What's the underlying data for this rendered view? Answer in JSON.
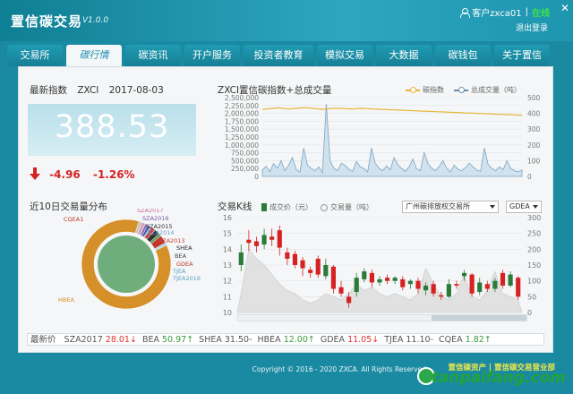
{
  "app": {
    "title": "置信碳交易",
    "version": "V1.0.0"
  },
  "user": {
    "label": "客户zxca01",
    "separator": "|",
    "status": "在线",
    "logout": "退出登录"
  },
  "tabs": [
    {
      "label": "交易所"
    },
    {
      "label": "碳行情"
    },
    {
      "label": "碳资讯"
    },
    {
      "label": "开户服务"
    },
    {
      "label": "投资者教育"
    },
    {
      "label": "模拟交易"
    },
    {
      "label": "大数据"
    },
    {
      "label": "碳钱包"
    },
    {
      "label": "关于置信"
    }
  ],
  "active_tab": "碳行情",
  "latest": {
    "heading": "最新指数",
    "code": "ZXCI",
    "date": "2017-08-03",
    "value": "388.53",
    "change": "-4.96",
    "change_pct": "-1.26%"
  },
  "index_chart": {
    "title": "ZXCI置信碳指数+总成交量",
    "legend_index": "碳指数",
    "legend_volume": "总成交量（吨）"
  },
  "donut": {
    "title": "近10日交易量分布"
  },
  "kline": {
    "title": "交易K线",
    "legend_price": "成交价（元）",
    "legend_volume": "交易量（吨）",
    "exchange_select": "广州碳排放权交易所",
    "code_select": "GDEA"
  },
  "ticker": {
    "label": "最新价",
    "items": [
      {
        "code": "SZA2017",
        "price": "28.01",
        "dir": "up",
        "arrow": "↓"
      },
      {
        "code": "BEA",
        "price": "50.97",
        "dir": "dn",
        "arrow": "↑"
      },
      {
        "code": "SHEA",
        "price": "31.50",
        "dir": "flat",
        "arrow": "-"
      },
      {
        "code": "HBEA",
        "price": "12.00",
        "dir": "dn",
        "arrow": "↑"
      },
      {
        "code": "GDEA",
        "price": "11.05",
        "dir": "up",
        "arrow": "↓"
      },
      {
        "code": "TJEA",
        "price": "11.10",
        "dir": "flat",
        "arrow": "-"
      },
      {
        "code": "CQEA",
        "price": "1.82",
        "dir": "dn",
        "arrow": "↑"
      }
    ]
  },
  "footer": {
    "copyright": "Copyright © 2016 - 2020 ZXCA. All Rights Reserved.",
    "right": "置信碳资产 | 置信碳交易营业部",
    "watermark": "tanpaifang.com"
  },
  "colors": {
    "accent": "#1d8fae",
    "index_line": "#e8b437",
    "volume_area": "#b8d5e6",
    "up": "#e0302e",
    "down": "#3a9a3a"
  },
  "chart_data": [
    {
      "type": "line",
      "title": "ZXCI置信碳指数+总成交量",
      "y_left_ticks": [
        "0",
        "250,000",
        "500,000",
        "750,000",
        "1,000,000",
        "1,250,000",
        "1,500,000",
        "1,750,000",
        "2,000,000",
        "2,250,000",
        "2,500,000"
      ],
      "y_right_ticks": [
        "0",
        "100",
        "200",
        "300",
        "400",
        "500"
      ],
      "ylim_left": [
        0,
        2500000
      ],
      "ylim_right": [
        0,
        500
      ],
      "series": [
        {
          "name": "碳指数",
          "axis": "right",
          "values": [
            425,
            428,
            430,
            432,
            435,
            433,
            430,
            428,
            430,
            432,
            434,
            436,
            435,
            433,
            430,
            428,
            426,
            428,
            430,
            432,
            433,
            432,
            430,
            429,
            428,
            430,
            432,
            431,
            430,
            428,
            427,
            426,
            425,
            424,
            423,
            422,
            421,
            420,
            419,
            418,
            417,
            416,
            415,
            414,
            413,
            412,
            411,
            410,
            409,
            408,
            407,
            406,
            405,
            404,
            403,
            402,
            401,
            400,
            399,
            398,
            397,
            396,
            395,
            394,
            393,
            392,
            391,
            390,
            389,
            388
          ]
        },
        {
          "name": "总成交量（吨）",
          "axis": "left",
          "values": [
            200000,
            320000,
            150000,
            410000,
            260000,
            500000,
            180000,
            350000,
            600000,
            220000,
            140000,
            900000,
            360000,
            250000,
            170000,
            300000,
            120000,
            2300000,
            500000,
            260000,
            180000,
            420000,
            350000,
            220000,
            160000,
            480000,
            300000,
            250000,
            140000,
            900000,
            420000,
            260000,
            180000,
            330000,
            210000,
            600000,
            380000,
            250000,
            160000,
            300000,
            550000,
            240000,
            180000,
            760000,
            420000,
            260000,
            180000,
            320000,
            500000,
            260000,
            140000,
            360000,
            220000,
            180000,
            280000,
            420000,
            300000,
            200000,
            160000,
            900000,
            380000,
            250000,
            180000,
            300000,
            220000,
            500000,
            260000,
            180000,
            150000,
            200000
          ]
        }
      ]
    },
    {
      "type": "pie",
      "title": "近10日交易量分布",
      "labels": [
        "SZA2017",
        "SZA2016",
        "SZA2015",
        "SZA2014",
        "SZA2013",
        "SHEA",
        "BEA",
        "GDEA",
        "TJEA",
        "TJEA2016",
        "HBEA",
        "CQEA1"
      ],
      "values": [
        1.5,
        1.0,
        1.0,
        0.5,
        1.5,
        2.0,
        1.0,
        3.0,
        0.5,
        0.5,
        86.5,
        1.0
      ]
    },
    {
      "type": "bar",
      "title": "交易K线",
      "y_left_ticks": [
        "10",
        "11",
        "12",
        "13",
        "14",
        "15",
        "16"
      ],
      "y_right_ticks": [
        "0",
        "50",
        "100",
        "150",
        "200",
        "250",
        "300"
      ],
      "ylim_left": [
        10,
        16
      ],
      "candles": [
        {
          "o": 13.0,
          "c": 13.8,
          "h": 14.3,
          "l": 12.6
        },
        {
          "o": 14.6,
          "c": 14.4,
          "h": 15.2,
          "l": 13.9
        },
        {
          "o": 14.5,
          "c": 14.2,
          "h": 14.8,
          "l": 13.8
        },
        {
          "o": 14.3,
          "c": 14.9,
          "h": 15.3,
          "l": 14.0
        },
        {
          "o": 14.8,
          "c": 14.6,
          "h": 15.3,
          "l": 14.2
        },
        {
          "o": 15.2,
          "c": 14.1,
          "h": 15.5,
          "l": 13.6
        },
        {
          "o": 13.8,
          "c": 13.4,
          "h": 14.1,
          "l": 13.0
        },
        {
          "o": 13.7,
          "c": 13.0,
          "h": 13.9,
          "l": 12.8
        },
        {
          "o": 13.3,
          "c": 12.8,
          "h": 13.5,
          "l": 12.3
        },
        {
          "o": 12.7,
          "c": 12.5,
          "h": 12.9,
          "l": 12.2
        },
        {
          "o": 13.4,
          "c": 12.4,
          "h": 13.6,
          "l": 12.2
        },
        {
          "o": 12.3,
          "c": 13.0,
          "h": 13.4,
          "l": 12.1
        },
        {
          "o": 12.9,
          "c": 11.5,
          "h": 13.0,
          "l": 11.2
        },
        {
          "o": 11.6,
          "c": 11.2,
          "h": 12.0,
          "l": 11.0
        },
        {
          "o": 11.0,
          "c": 10.6,
          "h": 11.3,
          "l": 10.3
        },
        {
          "o": 11.3,
          "c": 12.2,
          "h": 12.5,
          "l": 11.0
        },
        {
          "o": 12.1,
          "c": 12.6,
          "h": 12.8,
          "l": 11.9
        },
        {
          "o": 12.5,
          "c": 11.9,
          "h": 12.7,
          "l": 11.6
        },
        {
          "o": 11.9,
          "c": 12.1,
          "h": 12.3,
          "l": 11.7
        },
        {
          "o": 12.2,
          "c": 12.0,
          "h": 12.4,
          "l": 11.8
        },
        {
          "o": 12.0,
          "c": 12.2,
          "h": 12.3,
          "l": 11.8
        },
        {
          "o": 12.1,
          "c": 11.6,
          "h": 12.3,
          "l": 11.4
        },
        {
          "o": 11.8,
          "c": 12.0,
          "h": 12.1,
          "l": 11.5
        },
        {
          "o": 12.0,
          "c": 11.5,
          "h": 12.2,
          "l": 11.2
        },
        {
          "o": 11.4,
          "c": 11.7,
          "h": 11.9,
          "l": 11.1
        },
        {
          "o": 11.8,
          "c": 11.2,
          "h": 12.0,
          "l": 11.0
        },
        {
          "o": 11.1,
          "c": 11.0,
          "h": 11.3,
          "l": 10.8
        },
        {
          "o": 11.0,
          "c": 11.8,
          "h": 12.1,
          "l": 10.9
        },
        {
          "o": 11.8,
          "c": 11.7,
          "h": 12.0,
          "l": 11.5
        },
        {
          "o": 12.3,
          "c": 12.5,
          "h": 12.7,
          "l": 12.0
        },
        {
          "o": 12.4,
          "c": 11.2,
          "h": 12.5,
          "l": 11.0
        },
        {
          "o": 11.3,
          "c": 11.9,
          "h": 12.2,
          "l": 11.1
        },
        {
          "o": 11.8,
          "c": 11.5,
          "h": 12.0,
          "l": 11.3
        },
        {
          "o": 11.5,
          "c": 12.0,
          "h": 12.2,
          "l": 11.3
        },
        {
          "o": 12.5,
          "c": 11.7,
          "h": 12.7,
          "l": 11.5
        },
        {
          "o": 11.7,
          "c": 12.4,
          "h": 12.6,
          "l": 11.6
        },
        {
          "o": 12.2,
          "c": 11.0,
          "h": 12.3,
          "l": 10.8
        }
      ],
      "volume": [
        60,
        200,
        170,
        150,
        120,
        90,
        70,
        60,
        40,
        30,
        40,
        60,
        50,
        40,
        60,
        90,
        70,
        80,
        60,
        50,
        60,
        50,
        40,
        60,
        140,
        90,
        50,
        40,
        60,
        120,
        50,
        40,
        70,
        130,
        60,
        50,
        40
      ]
    }
  ]
}
